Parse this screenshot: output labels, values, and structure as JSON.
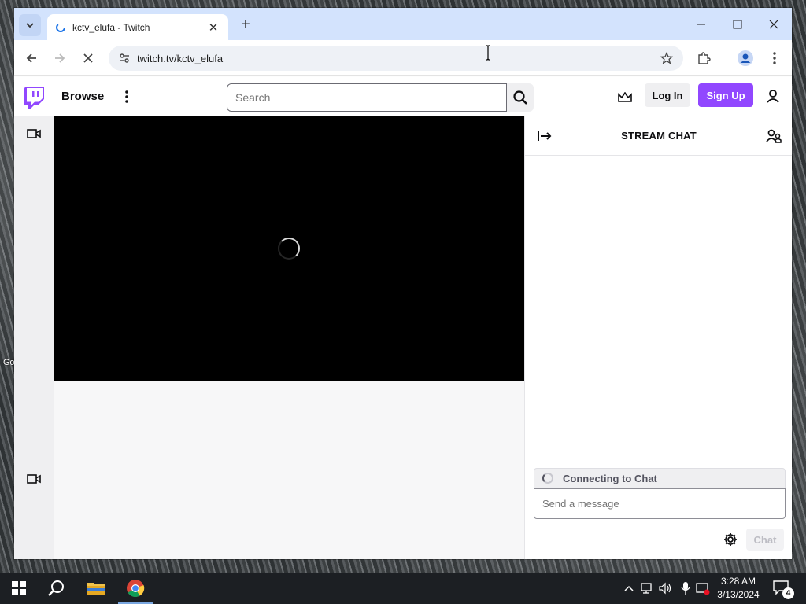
{
  "browser": {
    "tab_title": "kctv_elufa - Twitch",
    "url": "twitch.tv/kctv_elufa",
    "new_tab_symbol": "+"
  },
  "twitch_nav": {
    "browse": "Browse",
    "search_placeholder": "Search",
    "login": "Log In",
    "signup": "Sign Up",
    "brand_color": "#9147ff"
  },
  "chat": {
    "title": "STREAM CHAT",
    "status": "Connecting to Chat",
    "input_placeholder": "Send a message",
    "send_label": "Chat"
  },
  "taskbar": {
    "time": "3:28 AM",
    "date": "3/13/2024",
    "notification_count": "4"
  },
  "desktop": {
    "partial_icon_label": "Go"
  }
}
